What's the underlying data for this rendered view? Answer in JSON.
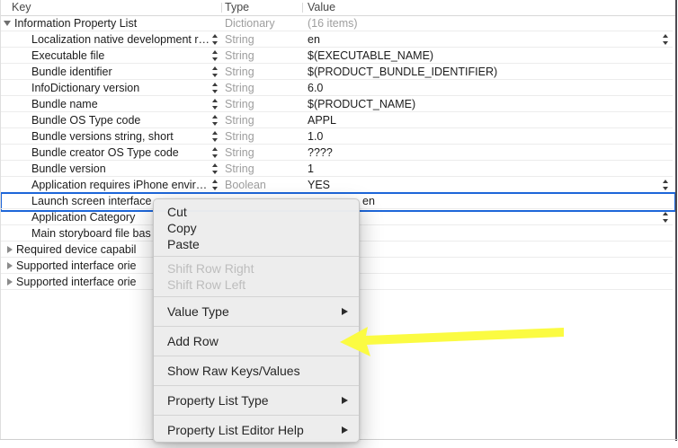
{
  "table": {
    "columns": [
      "Key",
      "Type",
      "Value"
    ],
    "rows": [
      {
        "key": "Information Property List",
        "disclosure": "down",
        "type": "Dictionary",
        "value": "(16 items)",
        "valueGray": true
      },
      {
        "key": "Localization native development r…",
        "keyStepper": true,
        "type": "String",
        "value": "en",
        "rightStepper": true
      },
      {
        "key": "Executable file",
        "keyStepper": true,
        "type": "String",
        "value": "$(EXECUTABLE_NAME)"
      },
      {
        "key": "Bundle identifier",
        "keyStepper": true,
        "type": "String",
        "value": "$(PRODUCT_BUNDLE_IDENTIFIER)"
      },
      {
        "key": "InfoDictionary version",
        "keyStepper": true,
        "type": "String",
        "value": "6.0"
      },
      {
        "key": "Bundle name",
        "keyStepper": true,
        "type": "String",
        "value": "$(PRODUCT_NAME)"
      },
      {
        "key": "Bundle OS Type code",
        "keyStepper": true,
        "type": "String",
        "value": "APPL"
      },
      {
        "key": "Bundle versions string, short",
        "keyStepper": true,
        "type": "String",
        "value": "1.0"
      },
      {
        "key": "Bundle creator OS Type code",
        "keyStepper": true,
        "type": "String",
        "value": "????"
      },
      {
        "key": "Bundle version",
        "keyStepper": true,
        "type": "String",
        "value": "1"
      },
      {
        "key": "Application requires iPhone envir…",
        "keyStepper": true,
        "type": "Boolean",
        "value": "YES",
        "rightStepper": true
      },
      {
        "key": "Launch screen interface",
        "selected": true,
        "type": "",
        "value": "en"
      },
      {
        "key": "Application Category",
        "type": "",
        "value": "",
        "rightStepper": true
      },
      {
        "key": "Main storyboard file bas",
        "type": "",
        "value": ""
      },
      {
        "key": "Required device capabil",
        "disclosure": "right",
        "type": "",
        "value": ""
      },
      {
        "key": "Supported interface orie",
        "disclosure": "right",
        "type": "",
        "value": ""
      },
      {
        "key": "Supported interface orie",
        "disclosure": "right",
        "type": "",
        "value": ""
      }
    ]
  },
  "menu": {
    "sections": [
      {
        "kind": "first",
        "items": [
          {
            "label": "Cut"
          },
          {
            "label": "Copy"
          },
          {
            "label": "Paste"
          }
        ]
      },
      {
        "kind": "compact",
        "items": [
          {
            "label": "Shift Row Right",
            "disabled": true
          },
          {
            "label": "Shift Row Left",
            "disabled": true
          }
        ]
      },
      {
        "kind": "lone",
        "items": [
          {
            "label": "Value Type",
            "submenu": true
          }
        ]
      },
      {
        "kind": "lone",
        "items": [
          {
            "label": "Add Row"
          }
        ]
      },
      {
        "kind": "lone",
        "items": [
          {
            "label": "Show Raw Keys/Values"
          }
        ]
      },
      {
        "kind": "lone",
        "items": [
          {
            "label": "Property List Type",
            "submenu": true
          }
        ]
      },
      {
        "kind": "last",
        "items": [
          {
            "label": "Property List Editor Help",
            "submenu": true
          }
        ]
      }
    ]
  },
  "annotation": {
    "arrow_color": "#fbfb42",
    "points_to": "Add Row"
  },
  "colors": {
    "selection_blue": "#1d66d9",
    "type_gray": "#9e9e9e",
    "menu_background": "#ececec",
    "pane_divider_dark": "#4d4950"
  }
}
